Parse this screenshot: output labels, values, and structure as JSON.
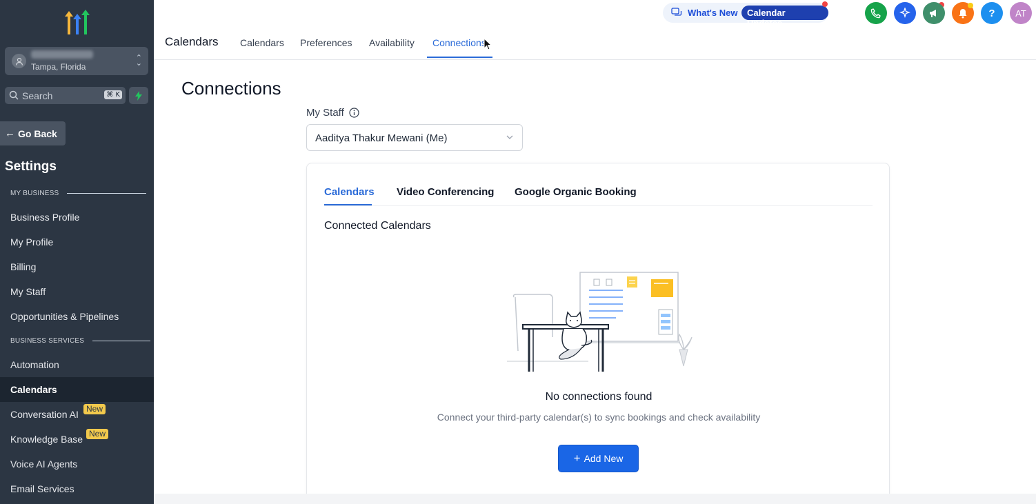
{
  "sidebar": {
    "location": {
      "subtitle": "Tampa, Florida"
    },
    "search": {
      "placeholder": "Search",
      "shortcut": "⌘ K"
    },
    "go_back": "Go Back",
    "settings_title": "Settings",
    "section_my_business": "MY BUSINESS",
    "section_business_services": "BUSINESS SERVICES",
    "items": [
      {
        "label": "Business Profile"
      },
      {
        "label": "My Profile"
      },
      {
        "label": "Billing"
      },
      {
        "label": "My Staff"
      },
      {
        "label": "Opportunities & Pipelines"
      },
      {
        "label": "Automation"
      },
      {
        "label": "Calendars",
        "active": true
      },
      {
        "label": "Conversation AI",
        "badge": "New"
      },
      {
        "label": "Knowledge Base",
        "badge": "New"
      },
      {
        "label": "Voice AI Agents"
      },
      {
        "label": "Email Services"
      }
    ]
  },
  "header": {
    "page_label": "Calendars",
    "tabs": [
      {
        "label": "Calendars"
      },
      {
        "label": "Preferences"
      },
      {
        "label": "Availability"
      },
      {
        "label": "Connections",
        "active": true
      }
    ],
    "whats_new": "What's New",
    "calendar_updates": "Calendar Updates",
    "help": "?",
    "avatar_initials": "AT",
    "colors": {
      "phone": "#16a34a",
      "ai": "#2563eb",
      "announce": "#3f8f6b",
      "bell": "#f97316",
      "help": "#1d8fef",
      "avatar": "#c084c8"
    }
  },
  "main": {
    "title": "Connections",
    "my_staff_label": "My Staff",
    "staff_selected": "Aaditya Thakur Mewani (Me)",
    "card": {
      "tabs": [
        {
          "label": "Calendars",
          "active": true
        },
        {
          "label": "Video Conferencing"
        },
        {
          "label": "Google Organic Booking"
        }
      ],
      "connected_title": "Connected Calendars",
      "empty_title": "No connections found",
      "empty_subtitle": "Connect your third-party calendar(s) to sync bookings and check availability",
      "add_button": "Add New"
    }
  },
  "colors": {
    "accent": "#2b6bd8",
    "sidebar_bg": "#2c3643",
    "badge": "#f2c94c",
    "primary_button": "#1a66e6"
  }
}
